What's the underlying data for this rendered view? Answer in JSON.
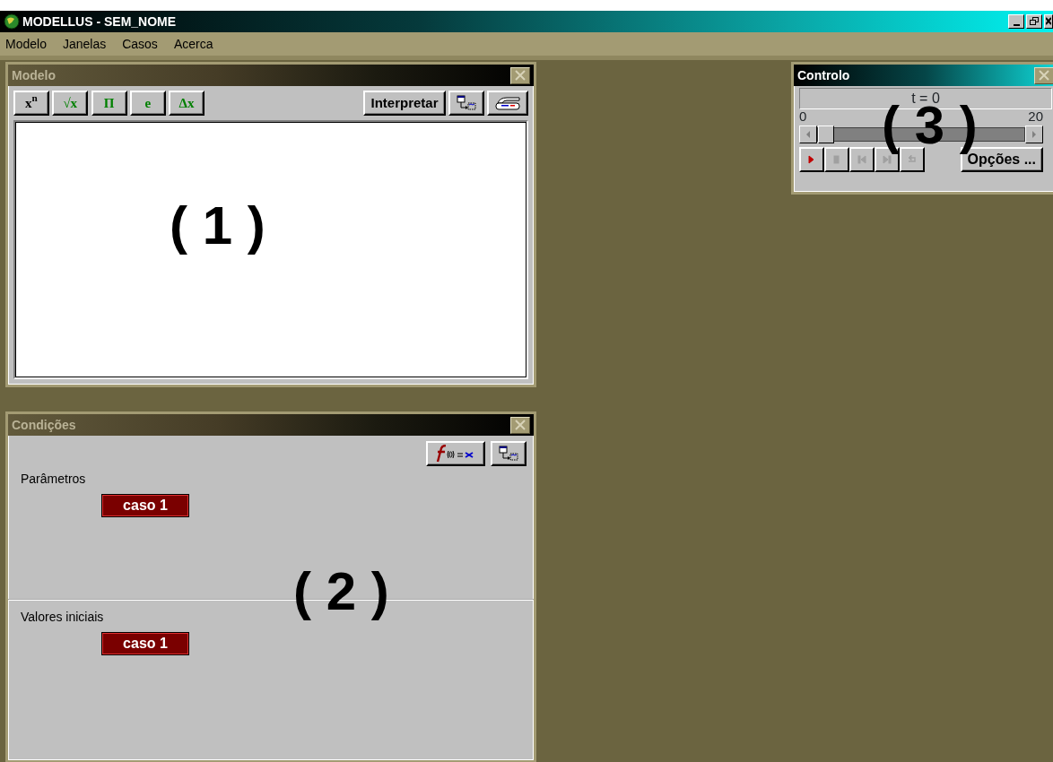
{
  "app": {
    "title": "MODELLUS - SEM_NOME"
  },
  "menu": [
    "Modelo",
    "Janelas",
    "Casos",
    "Acerca"
  ],
  "modelo": {
    "title": "Modelo",
    "annotation": "( 1 )",
    "tools": [
      {
        "label": "x$^{n}$",
        "color": "#000000"
      },
      {
        "label": "√x",
        "color": "#008000"
      },
      {
        "label": "Π",
        "color": "#008000"
      },
      {
        "label": "e",
        "color": "#008000"
      },
      {
        "label": "Δx",
        "color": "#008000"
      }
    ],
    "interpret": "Interpretar"
  },
  "condicoes": {
    "title": "Condições",
    "annotation": "( 2 )",
    "sections": [
      {
        "label": "Parâmetros",
        "cases": [
          "caso 1"
        ]
      },
      {
        "label": "Valores iniciais",
        "cases": [
          "caso 1"
        ]
      }
    ]
  },
  "controlo": {
    "title": "Controlo",
    "annotation": "( 3 )",
    "time": "t =  0",
    "min": "0",
    "max": "20",
    "level": 0,
    "playback": [
      {
        "kind": "play",
        "disabled": false
      },
      {
        "kind": "stop",
        "disabled": true
      },
      {
        "kind": "back",
        "disabled": true
      },
      {
        "kind": "forward",
        "disabled": true
      },
      {
        "kind": "reset",
        "disabled": true
      }
    ],
    "options": "Opções ..."
  }
}
